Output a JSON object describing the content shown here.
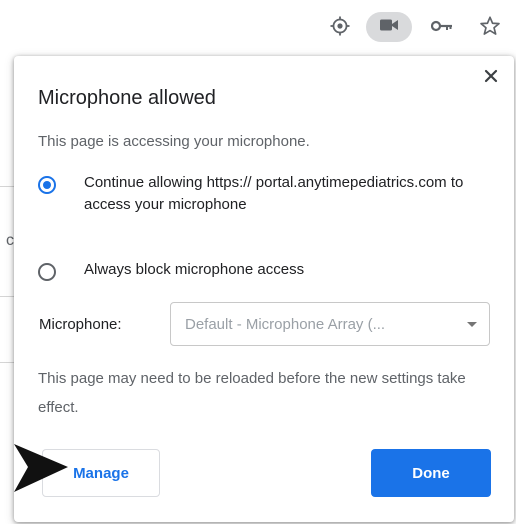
{
  "toolbar": {
    "icons": [
      "location-icon",
      "camera-icon",
      "key-icon",
      "star-icon"
    ]
  },
  "popup": {
    "title": "Microphone allowed",
    "subtitle": "This page is accessing your microphone.",
    "options": [
      {
        "label": "Continue allowing https:// portal.anytimepediatrics.com to access your microphone",
        "selected": true
      },
      {
        "label": "Always block microphone access",
        "selected": false
      }
    ],
    "microphone_label": "Microphone:",
    "microphone_select_value": "Default - Microphone Array (...",
    "note": "This page may need to be reloaded before the new settings take effect.",
    "manage_label": "Manage",
    "done_label": "Done"
  },
  "background_page": {
    "partial_char": "c"
  },
  "colors": {
    "accent": "#1a73e8",
    "camera_pill": "#d9dadc"
  }
}
